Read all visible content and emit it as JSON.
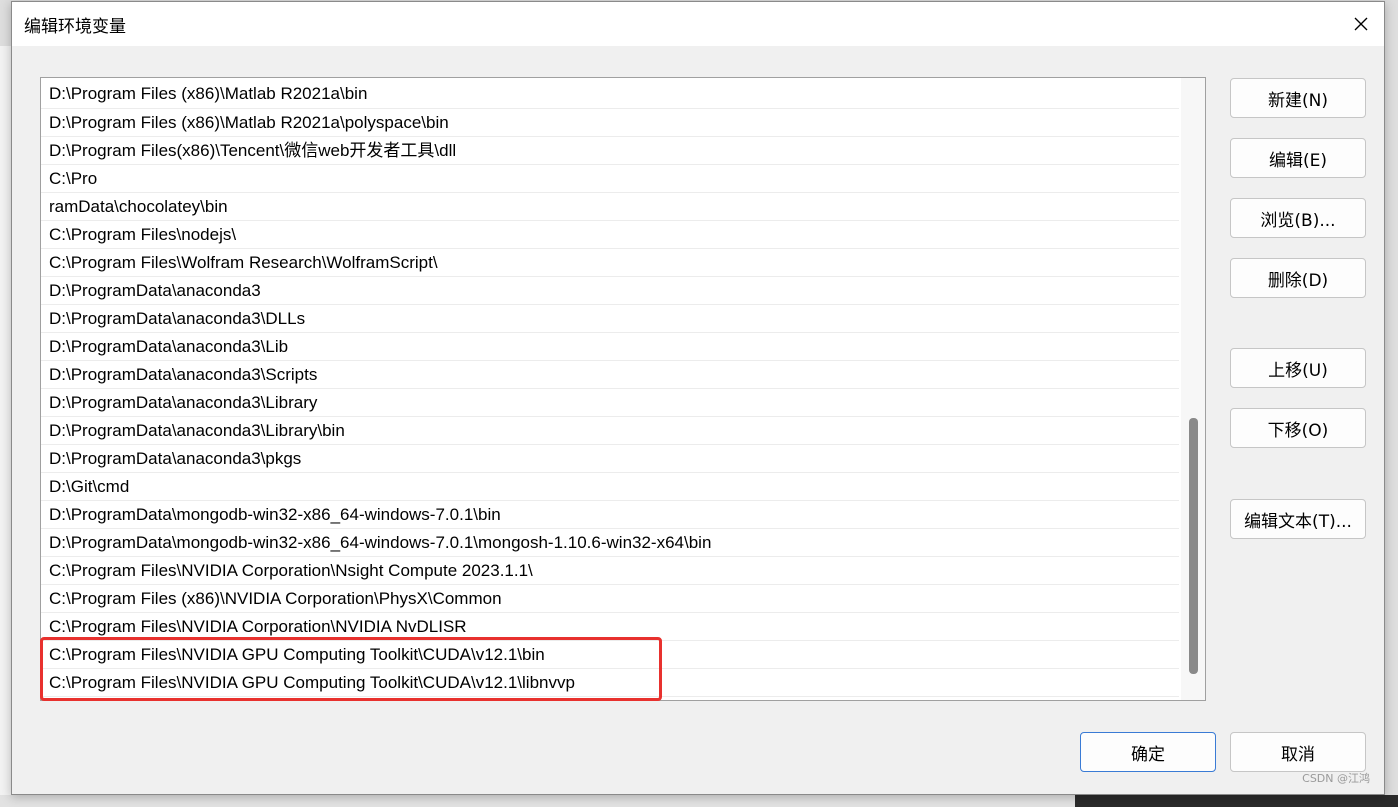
{
  "window": {
    "title": "编辑环境变量",
    "close_icon": "close-icon"
  },
  "path_list": {
    "items": [
      "D:\\Program Files (x86)\\Matlab R2021a\\bin",
      "D:\\Program Files (x86)\\Matlab R2021a\\polyspace\\bin",
      "D:\\Program Files(x86)\\Tencent\\微信web开发者工具\\dll",
      "C:\\Pro",
      "ramData\\chocolatey\\bin",
      "C:\\Program Files\\nodejs\\",
      "C:\\Program Files\\Wolfram Research\\WolframScript\\",
      "D:\\ProgramData\\anaconda3",
      "D:\\ProgramData\\anaconda3\\DLLs",
      "D:\\ProgramData\\anaconda3\\Lib",
      "D:\\ProgramData\\anaconda3\\Scripts",
      "D:\\ProgramData\\anaconda3\\Library",
      "D:\\ProgramData\\anaconda3\\Library\\bin",
      "D:\\ProgramData\\anaconda3\\pkgs",
      "D:\\Git\\cmd",
      "D:\\ProgramData\\mongodb-win32-x86_64-windows-7.0.1\\bin",
      "D:\\ProgramData\\mongodb-win32-x86_64-windows-7.0.1\\mongosh-1.10.6-win32-x64\\bin",
      "C:\\Program Files\\NVIDIA Corporation\\Nsight Compute 2023.1.1\\",
      "C:\\Program Files (x86)\\NVIDIA Corporation\\PhysX\\Common",
      "C:\\Program Files\\NVIDIA Corporation\\NVIDIA NvDLISR",
      "C:\\Program Files\\NVIDIA GPU Computing Toolkit\\CUDA\\v12.1\\bin",
      "C:\\Program Files\\NVIDIA GPU Computing Toolkit\\CUDA\\v12.1\\libnvvp"
    ]
  },
  "side_buttons": {
    "new": "新建(N)",
    "edit": "编辑(E)",
    "browse": "浏览(B)...",
    "delete": "删除(D)",
    "move_up": "上移(U)",
    "move_down": "下移(O)",
    "edit_text": "编辑文本(T)..."
  },
  "footer": {
    "ok": "确定",
    "cancel": "取消"
  },
  "watermark": "CSDN @江鸿",
  "colors": {
    "highlight_border": "#e8312e",
    "default_button_border": "#3a7bd5"
  }
}
